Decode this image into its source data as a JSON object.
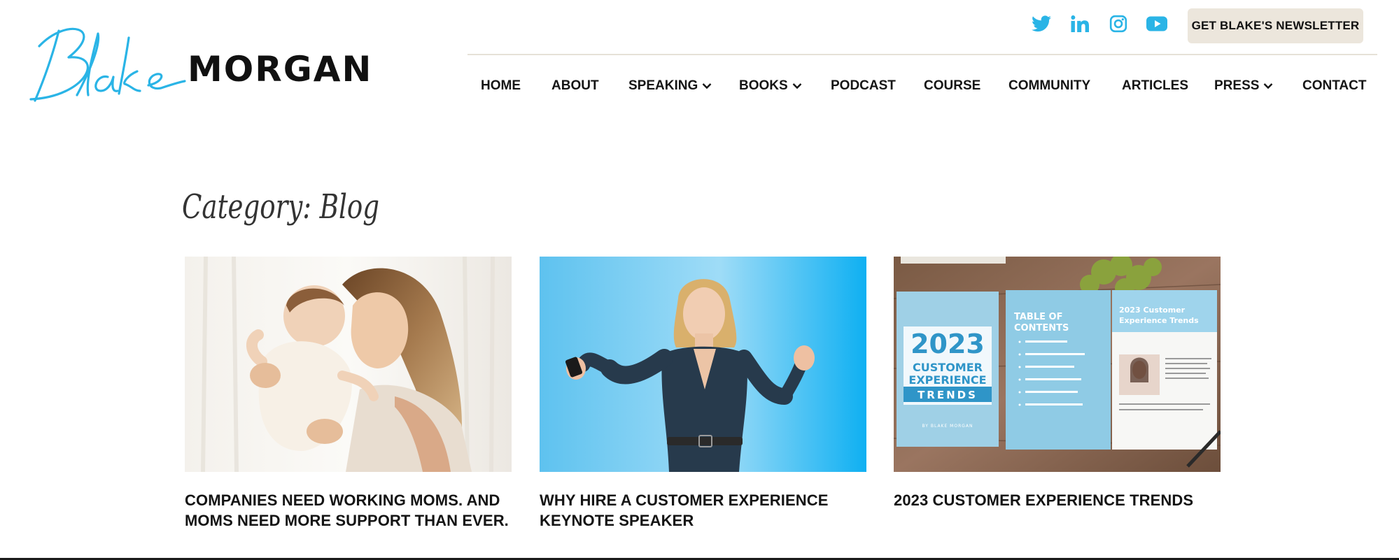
{
  "brand": {
    "script_name": "Blake",
    "block_name": "MORGAN",
    "accent_color": "#2ab4e6"
  },
  "social": [
    {
      "icon": "twitter-icon",
      "label": "Twitter"
    },
    {
      "icon": "linkedin-icon",
      "label": "LinkedIn"
    },
    {
      "icon": "instagram-icon",
      "label": "Instagram"
    },
    {
      "icon": "youtube-icon",
      "label": "YouTube"
    }
  ],
  "newsletter_button": "GET BLAKE'S NEWSLETTER",
  "nav": [
    {
      "label": "HOME"
    },
    {
      "label": "ABOUT"
    },
    {
      "label": "SPEAKING",
      "dropdown": true
    },
    {
      "label": "BOOKS",
      "dropdown": true
    },
    {
      "label": "PODCAST"
    },
    {
      "label": "COURSE"
    },
    {
      "label": "COMMUNITY"
    },
    {
      "label": "ARTICLES"
    },
    {
      "label": "PRESS",
      "dropdown": true
    },
    {
      "label": "CONTACT"
    }
  ],
  "page_title": "Category: Blog",
  "posts": [
    {
      "title": "COMPANIES NEED WORKING MOMS. AND MOMS NEED MORE SUPPORT THAN EVER.",
      "image": "mother-and-baby-photo"
    },
    {
      "title": "WHY HIRE A CUSTOMER EXPERIENCE KEYNOTE SPEAKER",
      "image": "speaker-on-blue-photo"
    },
    {
      "title": "2023 CUSTOMER EXPERIENCE TRENDS",
      "image": "trends-report-photo",
      "report": {
        "cover_year": "2023",
        "cover_line1": "CUSTOMER",
        "cover_line2": "EXPERIENCE",
        "cover_band": "TRENDS",
        "cover_byline": "BY BLAKE MORGAN",
        "toc_heading_1": "TABLE OF",
        "toc_heading_2": "CONTENTS",
        "right_heading_1": "2023 Customer",
        "right_heading_2": "Experience Trends"
      }
    }
  ]
}
